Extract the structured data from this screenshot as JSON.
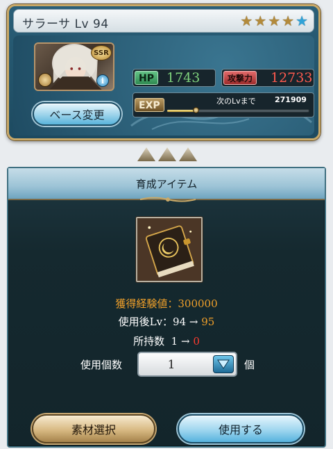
{
  "character": {
    "name_level": "サラーサ Lv 94",
    "stars": [
      "star-filled-icon",
      "star-filled-icon",
      "star-filled-icon",
      "star-filled-icon",
      "star-blue-icon"
    ],
    "rarity": "SSR",
    "hp_label": "HP",
    "hp_value": "1743",
    "atk_label": "攻撃力",
    "atk_value": "12733",
    "exp_label": "EXP",
    "exp_next_label": "次のLvまで",
    "exp_next_value": "271909",
    "exp_progress": 0.2,
    "base_change_button": "ベース変更"
  },
  "item_panel": {
    "title": "育成アイテム",
    "item_icon": "book-icon",
    "exp_gain_label": "獲得経験値：300000",
    "level_after_prefix": "使用後Lv：94 →",
    "level_after_value": "95",
    "owned_prefix": "所持数",
    "owned_current": "1",
    "owned_arrow": "→",
    "owned_after": "0",
    "quantity_label": "使用個数",
    "quantity_value": "1",
    "quantity_unit": "個",
    "select_material_button": "素材選択",
    "use_button": "使用する"
  },
  "colors": {
    "accent_orange": "#f0a02a",
    "accent_red": "#ff3b2f",
    "hp_green": "#7fd27c"
  }
}
